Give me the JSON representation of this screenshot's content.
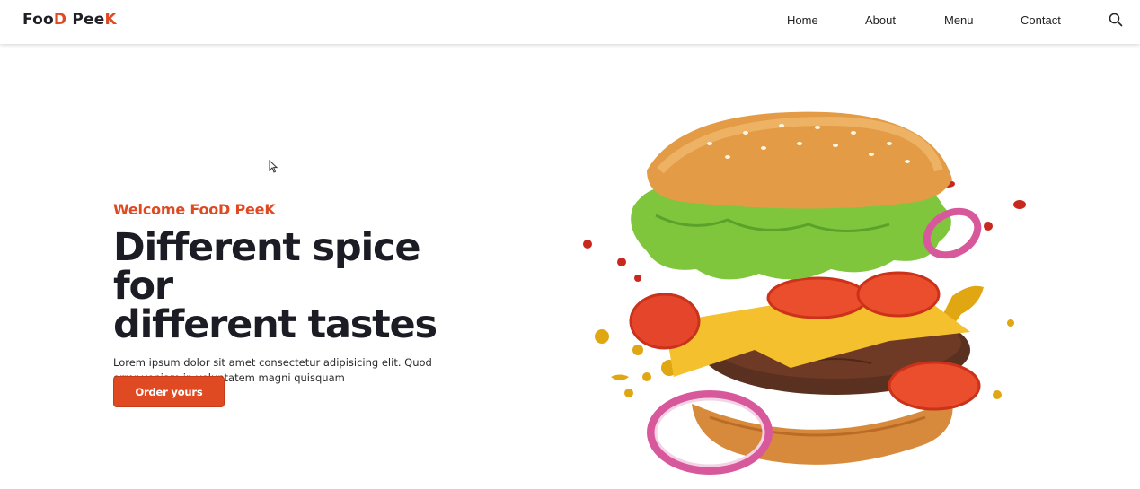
{
  "brand": {
    "part1": "Foo",
    "part2": "D",
    "part3": " Pee",
    "part4": "K"
  },
  "nav": {
    "items": [
      {
        "label": "Home"
      },
      {
        "label": "About"
      },
      {
        "label": "Menu"
      },
      {
        "label": "Contact"
      }
    ],
    "search_icon": "search-icon"
  },
  "hero": {
    "welcome": "Welcome FooD PeeK",
    "headline_line1": "Different spice for",
    "headline_line2": "different tastes",
    "lead": "Lorem ipsum dolor sit amet consectetur adipisicing elit. Quod error veniam in voluptatem magni quisquam",
    "cta_label": "Order yours",
    "image_subject": "burger-image"
  },
  "colors": {
    "accent": "#e04a23",
    "text": "#1c1c24",
    "background": "#ffffff"
  }
}
